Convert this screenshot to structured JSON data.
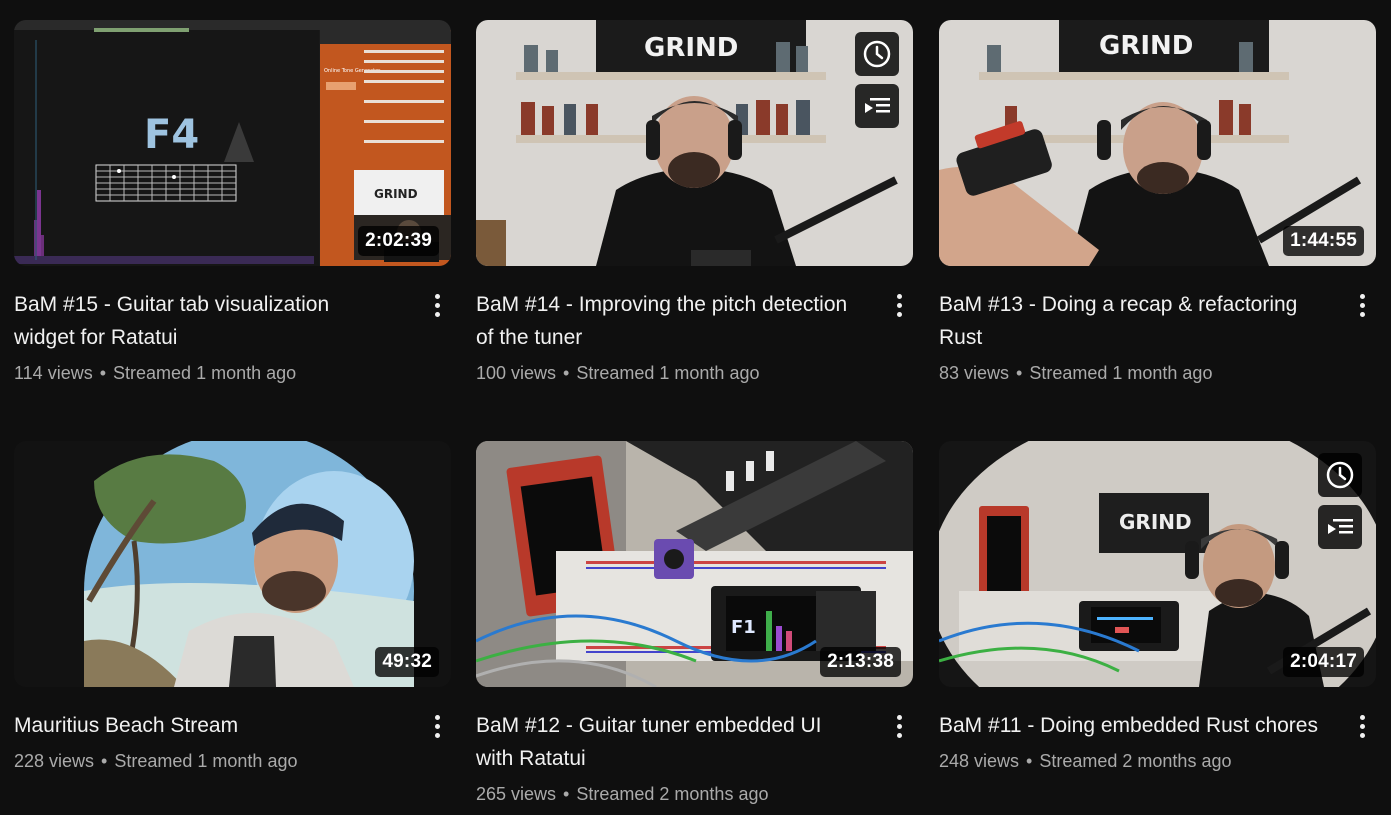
{
  "videos": [
    {
      "title": "BaM #15 - Guitar tab visualization widget for Ratatui",
      "views": "114 views",
      "sep": "•",
      "age": "Streamed 1 month ago",
      "duration": "2:02:39",
      "tuner_note": "F4",
      "watermark": "GRIND",
      "overlay_text": "Online Tone Generator"
    },
    {
      "title": "BaM #14 - Improving the pitch detection of the tuner",
      "views": "100 views",
      "sep": "•",
      "age": "Streamed 1 month ago",
      "duration": "",
      "watermark": "GRIND"
    },
    {
      "title": "BaM #13 - Doing a recap & refactoring Rust",
      "views": "83 views",
      "sep": "•",
      "age": "Streamed 1 month ago",
      "duration": "1:44:55",
      "watermark": "GRIND"
    },
    {
      "title": "Mauritius Beach Stream",
      "views": "228 views",
      "sep": "•",
      "age": "Streamed 1 month ago",
      "duration": "49:32"
    },
    {
      "title": "BaM #12 - Guitar tuner embedded UI with Ratatui",
      "views": "265 views",
      "sep": "•",
      "age": "Streamed 2 months ago",
      "duration": "2:13:38",
      "tuner_note": "F1"
    },
    {
      "title": "BaM #11 - Doing embedded Rust chores",
      "views": "248 views",
      "sep": "•",
      "age": "Streamed 2 months ago",
      "duration": "2:04:17",
      "watermark": "GRIND"
    }
  ],
  "icons": {
    "watch_later": "clock-icon",
    "add_to_queue": "add-to-queue-icon",
    "more": "more-vert-icon"
  },
  "colors": {
    "background": "#0f0f0f",
    "title": "#f1f1f1",
    "meta": "#aaaaaa",
    "duration_bg": "#000000"
  }
}
